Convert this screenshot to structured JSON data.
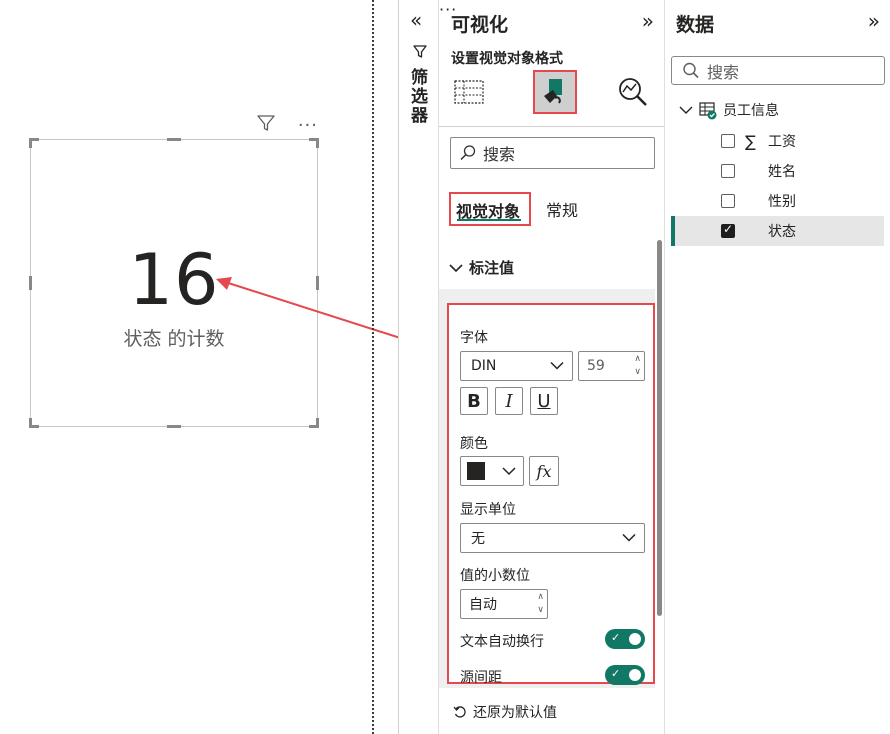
{
  "card": {
    "value": "16",
    "label": "状态 的计数"
  },
  "filters": {
    "label": "筛选器"
  },
  "visualizations": {
    "title": "可视化",
    "subtitle": "设置视觉对象格式",
    "search_placeholder": "搜索",
    "tabs": [
      "视觉对象",
      "常规"
    ],
    "more": "···",
    "section_title": "标注值",
    "font_label": "字体",
    "font_family": "DIN",
    "font_size": "59",
    "bold": "B",
    "italic": "I",
    "underline": "U",
    "color_label": "颜色",
    "color_value": "#252423",
    "fx": "fx",
    "display_units_label": "显示单位",
    "display_units_value": "无",
    "decimals_label": "值的小数位",
    "decimals_value": "自动",
    "word_wrap_label": "文本自动换行",
    "word_wrap_on": true,
    "spacing_label": "源间距",
    "spacing_on": true,
    "reset_label": "还原为默认值"
  },
  "data_pane": {
    "title": "数据",
    "search_placeholder": "搜索",
    "table_name": "员工信息",
    "fields": [
      {
        "name": "工资",
        "checked": false,
        "aggregate": true
      },
      {
        "name": "姓名",
        "checked": false,
        "aggregate": false
      },
      {
        "name": "性别",
        "checked": false,
        "aggregate": false
      },
      {
        "name": "状态",
        "checked": true,
        "aggregate": false
      }
    ]
  },
  "colors": {
    "accent": "#117865",
    "highlight_border": "#e5484d"
  }
}
